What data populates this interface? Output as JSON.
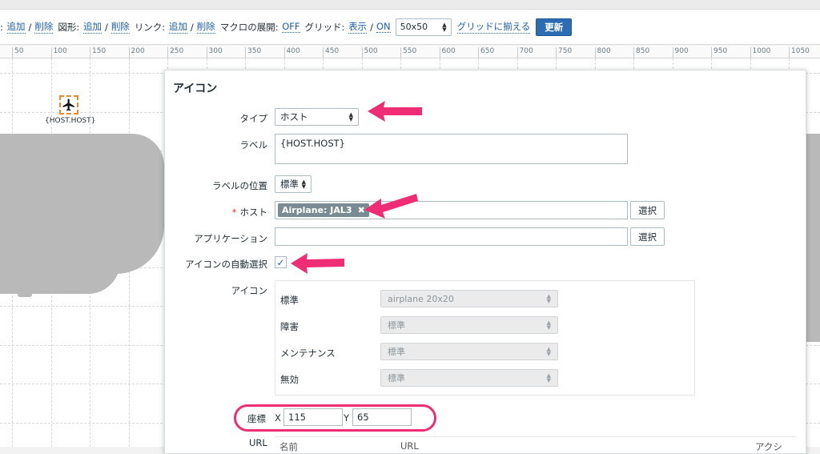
{
  "toolbar": {
    "element_label": "",
    "add1": "追加",
    "del1": "削除",
    "shape_label": "図形:",
    "add2": "追加",
    "del2": "削除",
    "link_label": "リンク:",
    "add3": "追加",
    "del3": "削除",
    "macro_label": "マクロの展開:",
    "macro_value": "OFF",
    "grid_label": "グリッド:",
    "grid_show": "表示",
    "grid_on": "ON",
    "grid_size": "50x50",
    "align_label": "グリッドに揃える",
    "update_label": "更新"
  },
  "ruler": [
    "50",
    "100",
    "150",
    "200",
    "250",
    "300",
    "350",
    "400",
    "450",
    "500",
    "550",
    "600",
    "650",
    "700",
    "750",
    "800",
    "850",
    "900",
    "950",
    "1000",
    "1050"
  ],
  "map_element": {
    "caption": "{HOST.HOST}",
    "icon": "airplane-icon"
  },
  "form": {
    "title": "アイコン",
    "type_label": "タイプ",
    "type_value": "ホスト",
    "label_label": "ラベル",
    "label_value": "{HOST.HOST}",
    "label_pos_label": "ラベルの位置",
    "label_pos_value": "標準",
    "host_label": "ホスト",
    "host_chip": "Airplane: JAL3",
    "select_btn": "選択",
    "app_label": "アプリケーション",
    "app_select_btn": "選択",
    "auto_icon_label": "アイコンの自動選択",
    "auto_icon_checked": true,
    "icon_label": "アイコン",
    "icons": [
      {
        "label": "標準",
        "value": "airplane 20x20"
      },
      {
        "label": "障害",
        "value": "標準"
      },
      {
        "label": "メンテナンス",
        "value": "標準"
      },
      {
        "label": "無効",
        "value": "標準"
      }
    ],
    "coord_label": "座標",
    "x_label": "X",
    "x_value": "115",
    "y_label": "Y",
    "y_value": "65",
    "url_label": "URL",
    "url_cols": {
      "name": "名前",
      "url": "URL",
      "action": "アクシ"
    }
  },
  "colors": {
    "accent": "#2b6cb2",
    "annotation": "#ef2d74",
    "selection": "#e8892a"
  }
}
